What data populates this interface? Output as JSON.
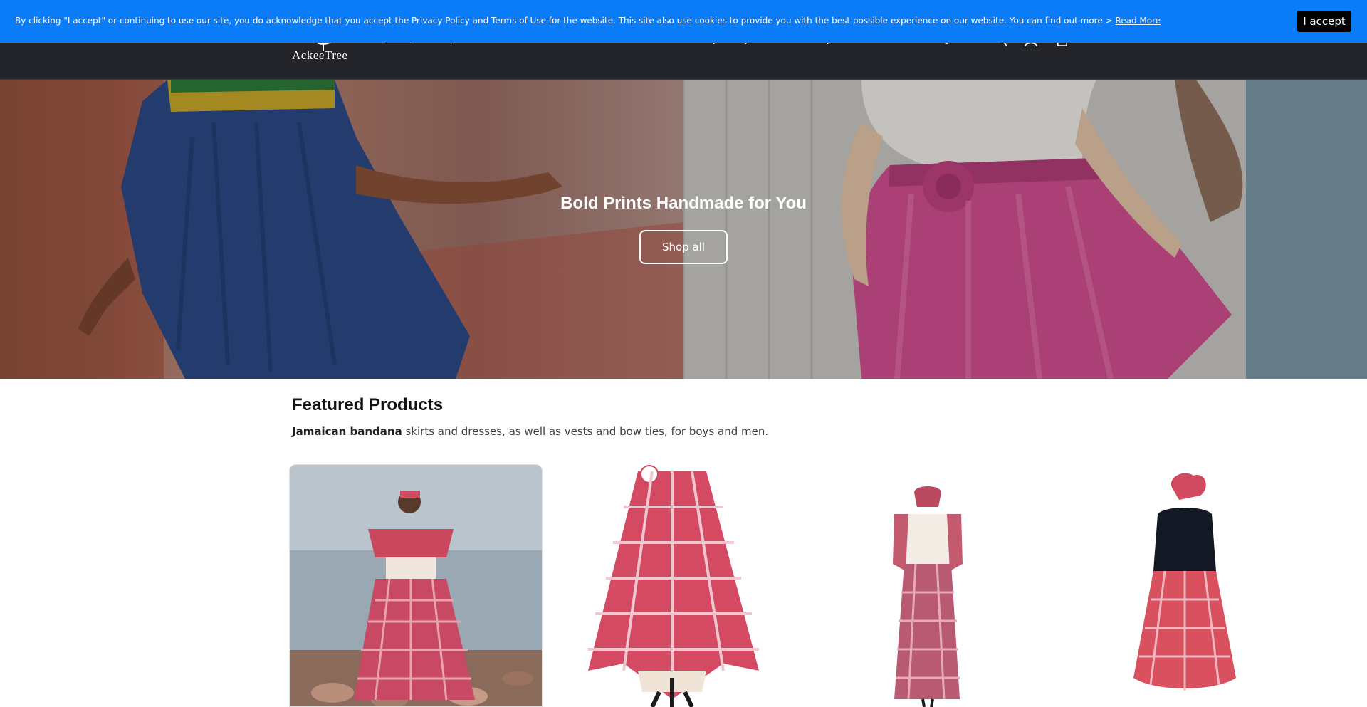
{
  "cookie_banner": {
    "text": "By clicking \"I accept\" or continuing to use our site, you do acknowledge that you accept the Privacy Policy and Terms of Use for the website. This site also use cookies to provide you with the best possible experience on our website. You can find out more >",
    "link_label": "Read More",
    "accept_label": "I accept",
    "background_color": "#0a7cf7"
  },
  "header": {
    "logo_text": "AckeeTree",
    "nav": [
      {
        "label": "Home",
        "active": true
      },
      {
        "label": "Shop",
        "has_dropdown": true
      },
      {
        "label": "About Us"
      },
      {
        "label": "Contact Us"
      },
      {
        "label": "Order Info"
      },
      {
        "label": "Privacy Policy"
      },
      {
        "label": "Return Policy"
      }
    ],
    "language": "English",
    "icons": [
      "search-icon",
      "account-icon",
      "cart-icon"
    ],
    "background_color": "#23252b"
  },
  "hero": {
    "title": "Bold Prints Handmade for You",
    "button_label": "Shop all"
  },
  "featured": {
    "title": "Featured Products",
    "desc_bold": "Jamaican bandana",
    "desc_rest": " skirts and dresses, as well as vests and bow ties, for boys and men."
  },
  "products": [
    {
      "image": "woman-in-bandana-dress-by-water"
    },
    {
      "image": "bandana-skirt-on-stand"
    },
    {
      "image": "bandana-dress-on-mannequin"
    },
    {
      "image": "bandana-skirt-on-dress-form"
    }
  ]
}
